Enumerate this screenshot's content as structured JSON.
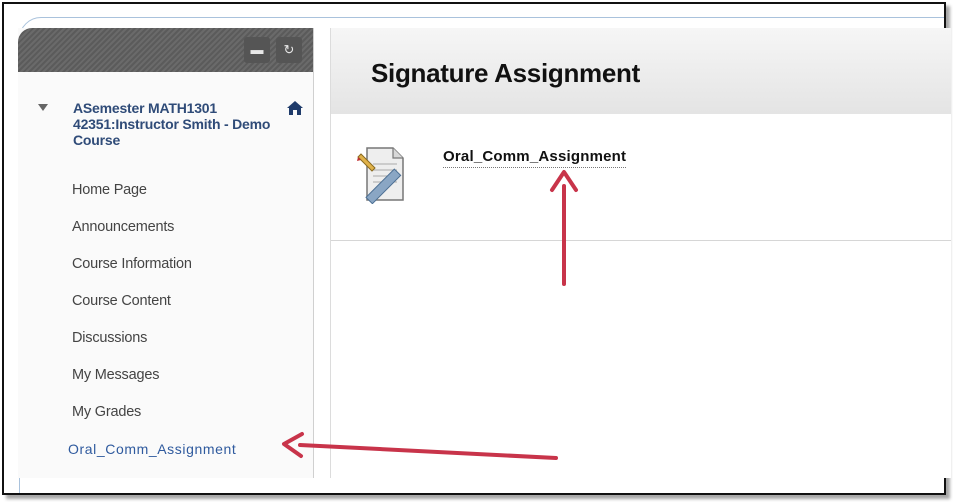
{
  "sidebar": {
    "header_buttons": [
      {
        "icon": "folder-icon",
        "glyph": "▬"
      },
      {
        "icon": "refresh-icon",
        "glyph": "↻"
      }
    ],
    "course": {
      "title": "ASemester MATH1301 42351:Instructor Smith - Demo Course",
      "home_icon": "home-icon"
    },
    "items": [
      {
        "label": "Home Page"
      },
      {
        "label": "Announcements"
      },
      {
        "label": "Course Information"
      },
      {
        "label": "Course Content"
      },
      {
        "label": "Discussions"
      },
      {
        "label": "My Messages"
      },
      {
        "label": "My Grades"
      },
      {
        "label": "Oral_Comm_Assignment",
        "active": true
      }
    ]
  },
  "content": {
    "page_title": "Signature Assignment",
    "items": [
      {
        "label": "Oral_Comm_Assignment",
        "icon": "assignment-icon"
      }
    ]
  },
  "colors": {
    "course_title": "#2f4b78",
    "active_link": "#2f5a9e",
    "annotation_arrow": "#c8344a"
  }
}
